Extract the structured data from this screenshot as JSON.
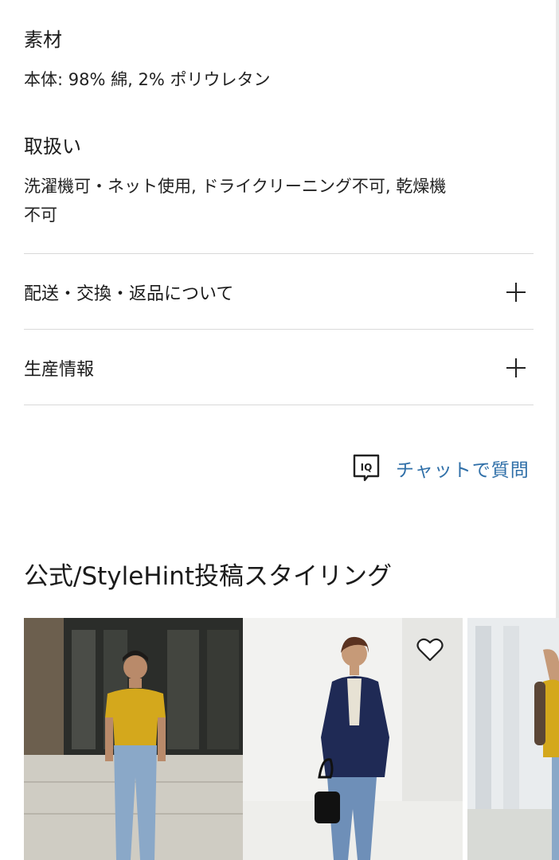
{
  "material": {
    "label": "素材",
    "value": "本体: 98% 綿, 2% ポリウレタン"
  },
  "care": {
    "label": "取扱い",
    "value_line1": "洗濯機可・ネット使用, ドライクリーニング不可, 乾燥機",
    "value_line2": "不可"
  },
  "accordions": [
    {
      "label": "配送・交換・返品について",
      "icon": "plus-icon"
    },
    {
      "label": "生産情報",
      "icon": "plus-icon"
    }
  ],
  "chat": {
    "icon_text": "IQ",
    "label": "チャットで質問"
  },
  "styling": {
    "title": "公式/StyleHint投稿スタイリング",
    "photos": [
      {
        "description": "woman-yellow-knit-jeans",
        "icon": "photo"
      },
      {
        "description": "woman-navy-jacket-jeans",
        "icon": "heart-icon"
      },
      {
        "description": "woman-yellow-top-partial",
        "icon": "photo"
      }
    ]
  },
  "colors": {
    "link": "#2f6fa8",
    "divider": "#d9d9d9",
    "text": "#1b1b1b"
  }
}
